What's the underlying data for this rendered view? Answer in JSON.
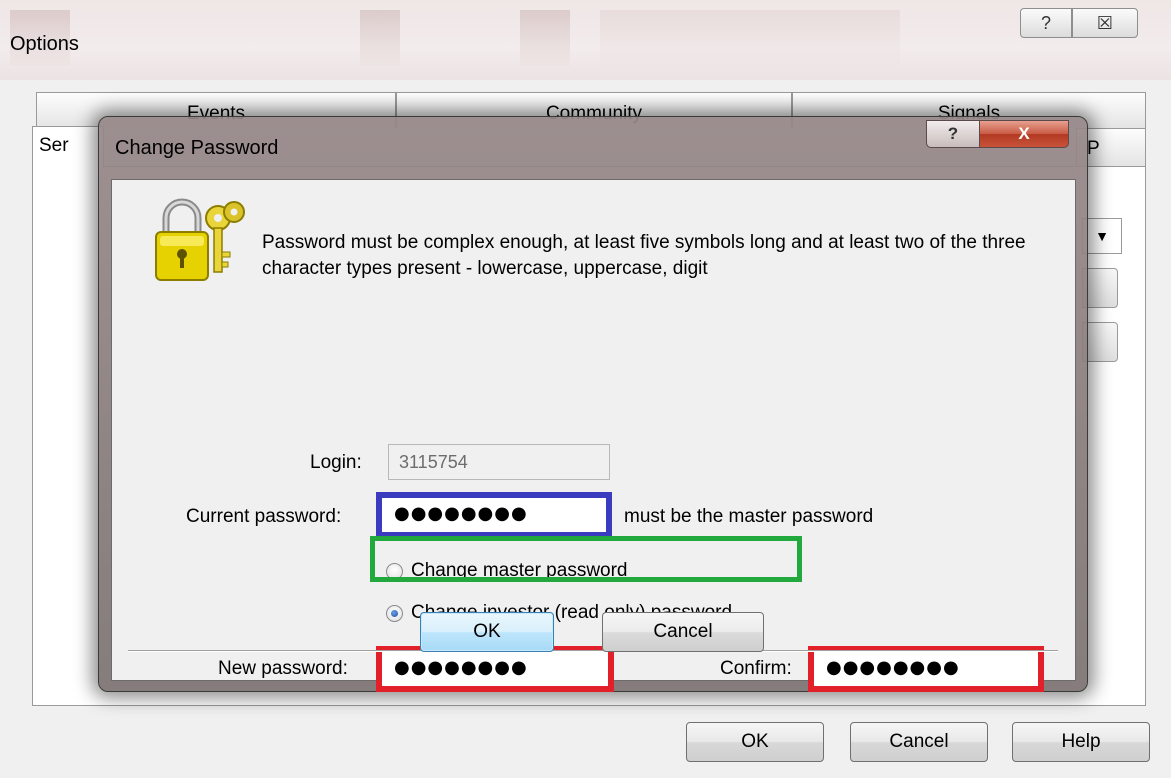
{
  "options_window": {
    "title": "Options",
    "help_glyph": "?",
    "close_glyph": "☒",
    "tabs": [
      {
        "label": "Events"
      },
      {
        "label": "Community"
      },
      {
        "label": "Signals"
      }
    ],
    "selected_tab_partial": "Ser",
    "right_tab_partial": "P",
    "dropdown_arrow": "▼",
    "buttons": {
      "ok": "OK",
      "cancel": "Cancel",
      "help": "Help"
    }
  },
  "change_password_dialog": {
    "title": "Change Password",
    "help_glyph": "?",
    "close_glyph": "X",
    "message": "Password must be complex enough, at least five symbols long and at least two of the three character types present - lowercase, uppercase, digit",
    "login": {
      "label": "Login:",
      "value": "3115754"
    },
    "current_password": {
      "label": "Current password:",
      "value": "●●●●●●●●",
      "hint": "must be the master password"
    },
    "radio_options": [
      {
        "label": "Change master password",
        "checked": false
      },
      {
        "label": "Change investor (read only) password",
        "checked": true
      }
    ],
    "new_password": {
      "label": "New password:",
      "value": "●●●●●●●●"
    },
    "confirm_password": {
      "label": "Confirm:",
      "value": "●●●●●●●●"
    },
    "buttons": {
      "ok": "OK",
      "cancel": "Cancel"
    }
  },
  "highlight_colors": {
    "current_password": "#3b3bc0",
    "investor_option": "#22a93e",
    "new_passwords": "#e2202a"
  }
}
